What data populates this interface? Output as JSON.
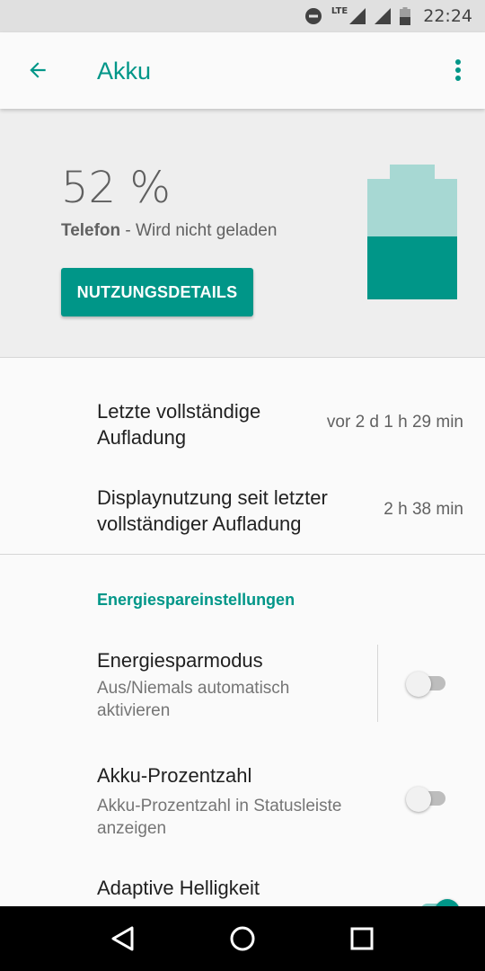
{
  "status_bar": {
    "time": "22:24",
    "network": "LTE",
    "icons": [
      "dnd-icon",
      "signal-icon",
      "signal-icon",
      "battery-icon"
    ]
  },
  "app_bar": {
    "title": "Akku",
    "back_icon": "arrow-back-icon",
    "menu_icon": "more-vert-icon"
  },
  "battery": {
    "percent_text": "52 %",
    "device": "Telefon",
    "charging_state": " - Wird nicht geladen",
    "button_label": "NUTZUNGSDETAILS",
    "level": 0.52
  },
  "info_rows": [
    {
      "title": "Letzte vollständige Aufladung",
      "value": "vor 2 d 1 h 29 min"
    },
    {
      "title": "Displaynutzung seit letzter vollständiger Aufladung",
      "value": "2 h 38 min"
    }
  ],
  "section": {
    "title": "Energiespareinstellungen"
  },
  "settings": [
    {
      "title": "Energiesparmodus",
      "summary": "Aus/Niemals automatisch aktivieren",
      "enabled": false
    },
    {
      "title": "Akku-Prozentzahl",
      "summary": "Akku-Prozentzahl in Statusleiste anzeigen",
      "enabled": false
    },
    {
      "title": "Adaptive Helligkeit",
      "summary": "",
      "enabled": true
    }
  ],
  "nav_bar": {
    "icons": [
      "back-triangle-icon",
      "home-circle-icon",
      "recents-square-icon"
    ]
  },
  "colors": {
    "accent": "#009688",
    "accent_light": "#a7d8d3",
    "statusbar": "#e0e0e0",
    "header_bg": "#eeeeee"
  }
}
